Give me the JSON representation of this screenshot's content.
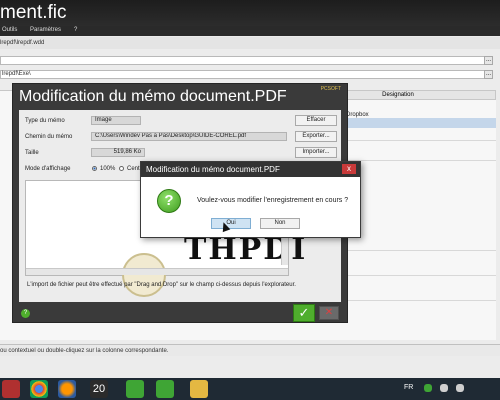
{
  "background_app": {
    "title": "ment.fic",
    "menu": [
      "Outils",
      "Paramètres",
      "?"
    ],
    "path": "lrepdf\\lrepdf.wdd",
    "field_path": "lrepdf\\Exe\\",
    "column_designation": "Designation",
    "row_text": "Dropbox",
    "status": "ou contextuel ou double-cliquez sur la colonne correspondante.",
    "btn_small": "..."
  },
  "memo_dialog": {
    "title": "Modification du mémo document.PDF",
    "logo_text": "PCSOFT",
    "fields": {
      "type_label": "Type du mémo",
      "type_value": "Image",
      "path_label": "Chemin du mémo",
      "path_value": "C:\\Users\\Windev Pas a Pas\\Desktop\\GUIDE-COREL.pdf",
      "size_label": "Taille",
      "size_value": "519,86 Ko",
      "display_label": "Mode d'affichage",
      "radio_100": "100%",
      "radio_center": "Centré"
    },
    "buttons": {
      "clear": "Effacer",
      "export": "Exporter...",
      "import": "Importer..."
    },
    "preview_text": "THPDI",
    "hint": "L'import de fichier peut être effectué par \"Drag and Drop\" sur le champ ci-dessus depuis l'explorateur.",
    "help_label": "?",
    "ok_label": "✓",
    "cancel_label": "✕"
  },
  "confirm_dialog": {
    "title": "Modification du mémo document.PDF",
    "close_label": "x",
    "icon_label": "?",
    "message": "Voulez-vous modifier l'enregistrement en cours ?",
    "yes_label": "Oui",
    "no_label": "Non"
  },
  "taskbar": {
    "language": "FR",
    "pinned_label": "20"
  },
  "colors": {
    "dialog_dark": "#3a3a3a",
    "accent_green": "#4fae2d",
    "close_red": "#c83a3a"
  }
}
